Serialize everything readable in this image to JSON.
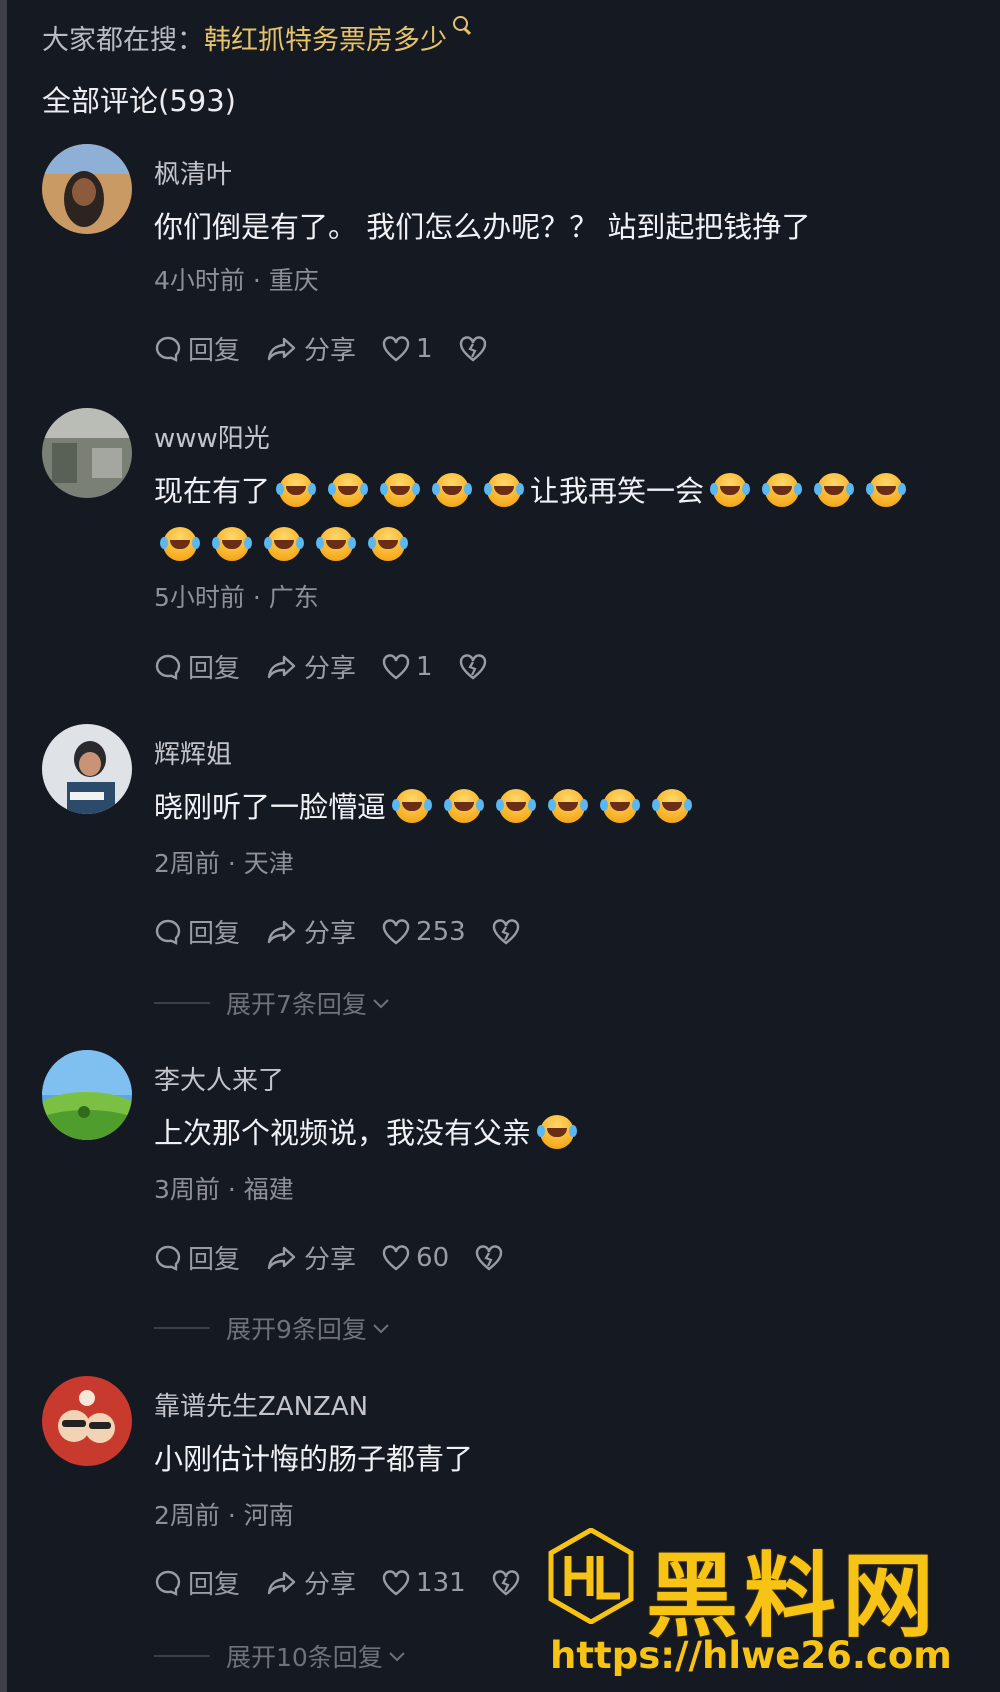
{
  "header": {
    "hot_prefix": "大家都在搜：",
    "hot_term": "韩红抓特务票房多少",
    "all_comments_label": "全部评论(593)"
  },
  "comments": [
    {
      "username": "枫清叶",
      "text": "你们倒是有了。 我们怎么办呢？？   站到起把钱挣了",
      "meta": "4小时前 · 重庆",
      "reply": "回复",
      "share": "分享",
      "likes": "1"
    },
    {
      "username": "www阳光",
      "text_a": "现在有了",
      "text_b": "让我再笑一会",
      "meta": "5小时前 · 广东",
      "reply": "回复",
      "share": "分享",
      "likes": "1"
    },
    {
      "username": "辉辉姐",
      "text": "晓刚听了一脸懵逼",
      "meta": "2周前 · 天津",
      "reply": "回复",
      "share": "分享",
      "likes": "253",
      "expand": "展开7条回复"
    },
    {
      "username": "李大人来了",
      "text": "上次那个视频说，我没有父亲",
      "meta": "3周前 · 福建",
      "reply": "回复",
      "share": "分享",
      "likes": "60",
      "expand": "展开9条回复"
    },
    {
      "username": "靠谱先生ZANZAN",
      "text": "小刚估计悔的肠子都青了",
      "meta": "2周前 · 河南",
      "reply": "回复",
      "share": "分享",
      "likes": "131",
      "expand": "展开10条回复"
    }
  ],
  "watermark": {
    "title": "黑料网",
    "url": "https://hlwe26.com",
    "color": "#f7c315"
  },
  "icons": [
    "comment-bubble-icon",
    "share-arrow-icon",
    "heart-icon",
    "broken-heart-icon",
    "chevron-down-icon",
    "laughing-tears-emoji"
  ]
}
